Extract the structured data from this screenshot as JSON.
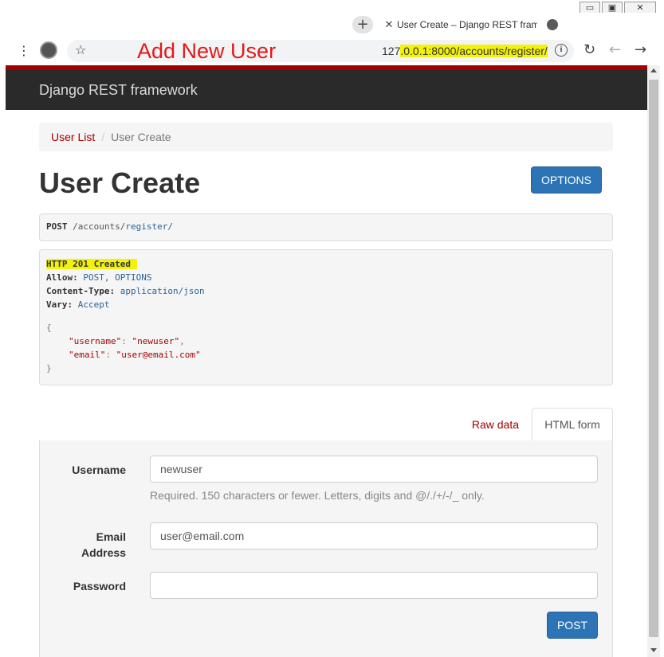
{
  "browser": {
    "window_controls": {
      "minimize": "▭",
      "restore": "▣",
      "close": "✕"
    },
    "new_tab_label": "+",
    "tab": {
      "close": "✕",
      "title": "User Create – Django REST frame"
    },
    "caption": "Add New User",
    "url": {
      "prefix": "127",
      "highlighted": ".0.0.1:8000/accounts/register/"
    },
    "info_icon": "i",
    "nav": {
      "reload": "↻",
      "back": "←",
      "forward": "→"
    },
    "menu": "⋮",
    "star": "☆"
  },
  "page": {
    "brand": "Django REST framework",
    "breadcrumb": {
      "link": "User List",
      "separator": "/",
      "active": "User Create"
    },
    "title": "User Create",
    "options_button": "OPTIONS",
    "request": {
      "method": "POST",
      "path_parts": [
        "/accounts/",
        "register",
        "/"
      ]
    },
    "response": {
      "status": "HTTP 201 Created",
      "headers": [
        {
          "key": "Allow:",
          "value": "POST, OPTIONS"
        },
        {
          "key": "Content-Type:",
          "value": "application/json"
        },
        {
          "key": "Vary:",
          "value": "Accept"
        }
      ],
      "body": {
        "open": "{",
        "lines": [
          {
            "key": "\"username\"",
            "value": "\"newuser\"",
            "comma": ","
          },
          {
            "key": "\"email\"",
            "value": "\"user@email.com\"",
            "comma": ""
          }
        ],
        "close": "}"
      }
    },
    "tabs": {
      "raw": "Raw data",
      "html": "HTML form"
    },
    "form": {
      "username": {
        "label": "Username",
        "value": "newuser",
        "help": "Required. 150 characters or fewer. Letters, digits and @/./+/-/_ only."
      },
      "email": {
        "label_line1": "Email",
        "label_line2": "Address",
        "value": "user@email.com"
      },
      "password": {
        "label": "Password",
        "value": ""
      },
      "submit": "POST"
    }
  },
  "colors": {
    "brand_red": "#a30000",
    "button_blue": "#2c74b5",
    "highlight_yellow": "#f2f20a",
    "caption_red": "#e11a1a"
  }
}
